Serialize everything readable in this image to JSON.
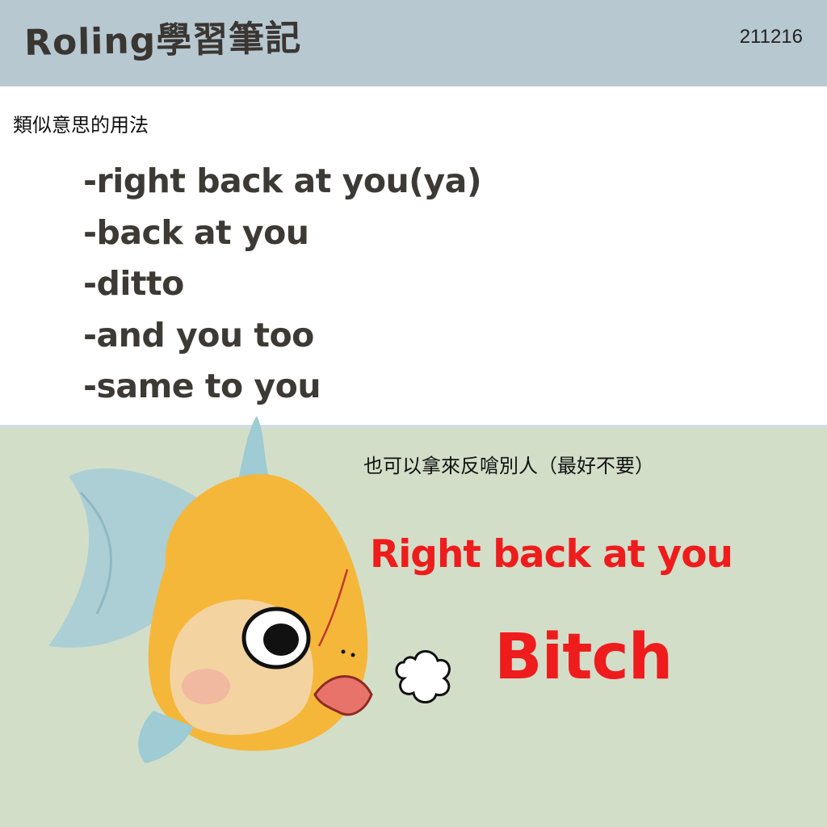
{
  "header": {
    "brand": "Roling學習筆記",
    "date": "211216"
  },
  "section": {
    "label": "類似意思的用法",
    "phrases": [
      "-right back at you(ya)",
      "-back at you",
      "-ditto",
      "-and you too",
      "-same to you"
    ]
  },
  "meme": {
    "note": "也可以拿來反嗆別人（最好不要）",
    "slogan_line1": "Right back at you",
    "slogan_line2": "Bitch",
    "illustration": "goldfish-icon",
    "effect": "puff-cloud-icon"
  },
  "colors": {
    "header_bg": "#b7c8d1",
    "bottom_bg": "#d3dec9",
    "slogan_red": "#ee1c1c",
    "phrase_text": "#3d3a36"
  }
}
